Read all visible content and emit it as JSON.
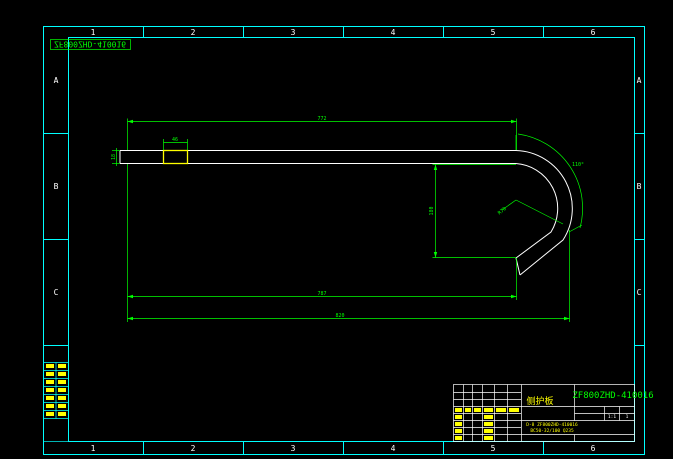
{
  "colors": {
    "frame": "#00ffff",
    "dim": "#00ff00",
    "part": "#ffffff",
    "highlight": "#ffff00",
    "title_text": "#00ff00",
    "background": "#000000"
  },
  "grid": {
    "columns": [
      "1",
      "2",
      "3",
      "4",
      "5",
      "6"
    ],
    "rows": [
      "A",
      "B",
      "C"
    ]
  },
  "drawing_number": "ZF800ZHD-410016",
  "drawing_number_rotated": "ZF800ZHD-410016",
  "dimensions": {
    "top_length": "772",
    "bottom_length": "787",
    "overall_length": "820",
    "height": "180",
    "thickness": "18",
    "slot_width": "46",
    "arc_angle": "110°",
    "radius": "R70"
  },
  "title_block": {
    "part_name": "侧护板",
    "small_text_1": "D-8 ZF800ZHD-410016",
    "small_text_2": "BC50-32/100 Q235",
    "scale": "1:1",
    "sheet": "1"
  }
}
